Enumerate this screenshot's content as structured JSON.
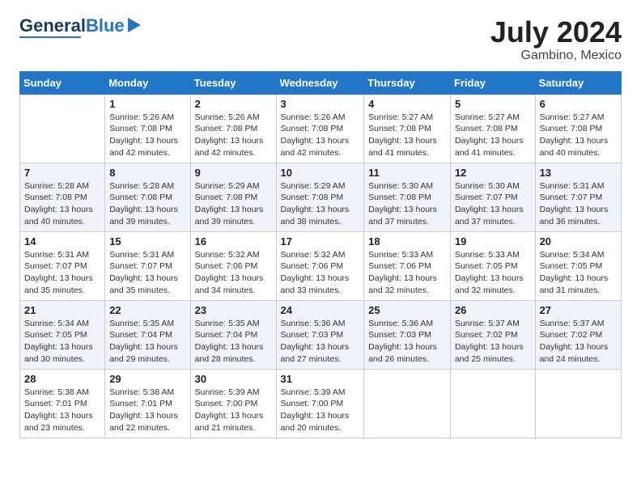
{
  "header": {
    "logo_line1": "General",
    "logo_line2": "Blue",
    "month_year": "July 2024",
    "location": "Gambino, Mexico"
  },
  "weekdays": [
    "Sunday",
    "Monday",
    "Tuesday",
    "Wednesday",
    "Thursday",
    "Friday",
    "Saturday"
  ],
  "weeks": [
    [
      {
        "day": "",
        "info": ""
      },
      {
        "day": "1",
        "info": "Sunrise: 5:26 AM\nSunset: 7:08 PM\nDaylight: 13 hours\nand 42 minutes."
      },
      {
        "day": "2",
        "info": "Sunrise: 5:26 AM\nSunset: 7:08 PM\nDaylight: 13 hours\nand 42 minutes."
      },
      {
        "day": "3",
        "info": "Sunrise: 5:26 AM\nSunset: 7:08 PM\nDaylight: 13 hours\nand 42 minutes."
      },
      {
        "day": "4",
        "info": "Sunrise: 5:27 AM\nSunset: 7:08 PM\nDaylight: 13 hours\nand 41 minutes."
      },
      {
        "day": "5",
        "info": "Sunrise: 5:27 AM\nSunset: 7:08 PM\nDaylight: 13 hours\nand 41 minutes."
      },
      {
        "day": "6",
        "info": "Sunrise: 5:27 AM\nSunset: 7:08 PM\nDaylight: 13 hours\nand 40 minutes."
      }
    ],
    [
      {
        "day": "7",
        "info": "Sunrise: 5:28 AM\nSunset: 7:08 PM\nDaylight: 13 hours\nand 40 minutes."
      },
      {
        "day": "8",
        "info": "Sunrise: 5:28 AM\nSunset: 7:08 PM\nDaylight: 13 hours\nand 39 minutes."
      },
      {
        "day": "9",
        "info": "Sunrise: 5:29 AM\nSunset: 7:08 PM\nDaylight: 13 hours\nand 39 minutes."
      },
      {
        "day": "10",
        "info": "Sunrise: 5:29 AM\nSunset: 7:08 PM\nDaylight: 13 hours\nand 38 minutes."
      },
      {
        "day": "11",
        "info": "Sunrise: 5:30 AM\nSunset: 7:08 PM\nDaylight: 13 hours\nand 37 minutes."
      },
      {
        "day": "12",
        "info": "Sunrise: 5:30 AM\nSunset: 7:07 PM\nDaylight: 13 hours\nand 37 minutes."
      },
      {
        "day": "13",
        "info": "Sunrise: 5:31 AM\nSunset: 7:07 PM\nDaylight: 13 hours\nand 36 minutes."
      }
    ],
    [
      {
        "day": "14",
        "info": "Sunrise: 5:31 AM\nSunset: 7:07 PM\nDaylight: 13 hours\nand 35 minutes."
      },
      {
        "day": "15",
        "info": "Sunrise: 5:31 AM\nSunset: 7:07 PM\nDaylight: 13 hours\nand 35 minutes."
      },
      {
        "day": "16",
        "info": "Sunrise: 5:32 AM\nSunset: 7:06 PM\nDaylight: 13 hours\nand 34 minutes."
      },
      {
        "day": "17",
        "info": "Sunrise: 5:32 AM\nSunset: 7:06 PM\nDaylight: 13 hours\nand 33 minutes."
      },
      {
        "day": "18",
        "info": "Sunrise: 5:33 AM\nSunset: 7:06 PM\nDaylight: 13 hours\nand 32 minutes."
      },
      {
        "day": "19",
        "info": "Sunrise: 5:33 AM\nSunset: 7:05 PM\nDaylight: 13 hours\nand 32 minutes."
      },
      {
        "day": "20",
        "info": "Sunrise: 5:34 AM\nSunset: 7:05 PM\nDaylight: 13 hours\nand 31 minutes."
      }
    ],
    [
      {
        "day": "21",
        "info": "Sunrise: 5:34 AM\nSunset: 7:05 PM\nDaylight: 13 hours\nand 30 minutes."
      },
      {
        "day": "22",
        "info": "Sunrise: 5:35 AM\nSunset: 7:04 PM\nDaylight: 13 hours\nand 29 minutes."
      },
      {
        "day": "23",
        "info": "Sunrise: 5:35 AM\nSunset: 7:04 PM\nDaylight: 13 hours\nand 28 minutes."
      },
      {
        "day": "24",
        "info": "Sunrise: 5:36 AM\nSunset: 7:03 PM\nDaylight: 13 hours\nand 27 minutes."
      },
      {
        "day": "25",
        "info": "Sunrise: 5:36 AM\nSunset: 7:03 PM\nDaylight: 13 hours\nand 26 minutes."
      },
      {
        "day": "26",
        "info": "Sunrise: 5:37 AM\nSunset: 7:02 PM\nDaylight: 13 hours\nand 25 minutes."
      },
      {
        "day": "27",
        "info": "Sunrise: 5:37 AM\nSunset: 7:02 PM\nDaylight: 13 hours\nand 24 minutes."
      }
    ],
    [
      {
        "day": "28",
        "info": "Sunrise: 5:38 AM\nSunset: 7:01 PM\nDaylight: 13 hours\nand 23 minutes."
      },
      {
        "day": "29",
        "info": "Sunrise: 5:38 AM\nSunset: 7:01 PM\nDaylight: 13 hours\nand 22 minutes."
      },
      {
        "day": "30",
        "info": "Sunrise: 5:39 AM\nSunset: 7:00 PM\nDaylight: 13 hours\nand 21 minutes."
      },
      {
        "day": "31",
        "info": "Sunrise: 5:39 AM\nSunset: 7:00 PM\nDaylight: 13 hours\nand 20 minutes."
      },
      {
        "day": "",
        "info": ""
      },
      {
        "day": "",
        "info": ""
      },
      {
        "day": "",
        "info": ""
      }
    ]
  ]
}
